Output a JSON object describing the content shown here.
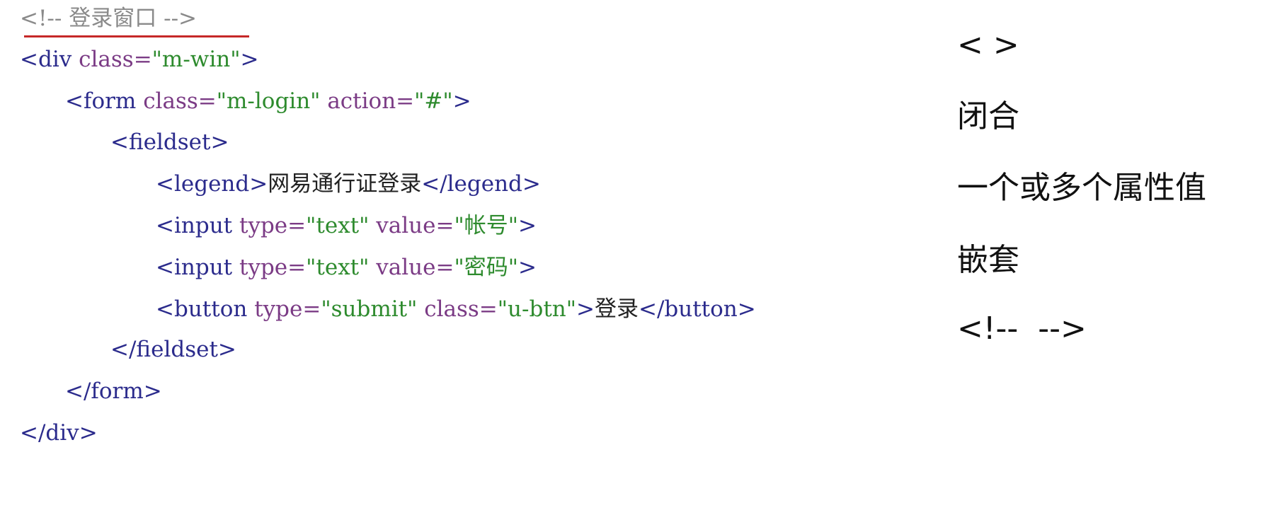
{
  "code": {
    "lines": [
      {
        "indent": 0,
        "tokens": [
          {
            "t": "<!-- 登录窗口 -->",
            "k": "comment"
          }
        ]
      },
      {
        "indent": 0,
        "tokens": [
          {
            "t": "<div ",
            "k": "tag"
          },
          {
            "t": "class",
            "k": "attr"
          },
          {
            "t": "=",
            "k": "eq"
          },
          {
            "t": "\"m-win\"",
            "k": "str"
          },
          {
            "t": ">",
            "k": "tag"
          }
        ]
      },
      {
        "indent": 1,
        "tokens": [
          {
            "t": "<form ",
            "k": "tag"
          },
          {
            "t": "class",
            "k": "attr"
          },
          {
            "t": "=",
            "k": "eq"
          },
          {
            "t": "\"m-login\"",
            "k": "str"
          },
          {
            "t": " ",
            "k": "text"
          },
          {
            "t": "action",
            "k": "attr"
          },
          {
            "t": "=",
            "k": "eq"
          },
          {
            "t": "\"#\"",
            "k": "str"
          },
          {
            "t": ">",
            "k": "tag"
          }
        ]
      },
      {
        "indent": 2,
        "tokens": [
          {
            "t": "<fieldset>",
            "k": "tag"
          }
        ]
      },
      {
        "indent": 3,
        "tokens": [
          {
            "t": "<legend>",
            "k": "tag"
          },
          {
            "t": "网易通行证登录",
            "k": "text"
          },
          {
            "t": "</legend>",
            "k": "tag"
          }
        ]
      },
      {
        "indent": 3,
        "tokens": [
          {
            "t": "<input ",
            "k": "tag"
          },
          {
            "t": "type",
            "k": "attr"
          },
          {
            "t": "=",
            "k": "eq"
          },
          {
            "t": "\"text\"",
            "k": "str"
          },
          {
            "t": " ",
            "k": "text"
          },
          {
            "t": "value",
            "k": "attr"
          },
          {
            "t": "=",
            "k": "eq"
          },
          {
            "t": "\"帐号\"",
            "k": "str"
          },
          {
            "t": ">",
            "k": "tag"
          }
        ]
      },
      {
        "indent": 3,
        "tokens": [
          {
            "t": "<input ",
            "k": "tag"
          },
          {
            "t": "type",
            "k": "attr"
          },
          {
            "t": "=",
            "k": "eq"
          },
          {
            "t": "\"text\"",
            "k": "str"
          },
          {
            "t": " ",
            "k": "text"
          },
          {
            "t": "value",
            "k": "attr"
          },
          {
            "t": "=",
            "k": "eq"
          },
          {
            "t": "\"密码\"",
            "k": "str"
          },
          {
            "t": ">",
            "k": "tag"
          }
        ]
      },
      {
        "indent": 3,
        "tokens": [
          {
            "t": "<button ",
            "k": "tag"
          },
          {
            "t": "type",
            "k": "attr"
          },
          {
            "t": "=",
            "k": "eq"
          },
          {
            "t": "\"submit\"",
            "k": "str"
          },
          {
            "t": " ",
            "k": "text"
          },
          {
            "t": "class",
            "k": "attr"
          },
          {
            "t": "=",
            "k": "eq"
          },
          {
            "t": "\"u-btn\"",
            "k": "str"
          },
          {
            "t": ">",
            "k": "tag"
          },
          {
            "t": "登录",
            "k": "text"
          },
          {
            "t": "</button>",
            "k": "tag"
          }
        ]
      },
      {
        "indent": 2,
        "tokens": [
          {
            "t": "</fieldset>",
            "k": "tag"
          }
        ]
      },
      {
        "indent": 1,
        "tokens": [
          {
            "t": "</form>",
            "k": "tag"
          }
        ]
      },
      {
        "indent": 0,
        "tokens": [
          {
            "t": "</div>",
            "k": "tag"
          }
        ]
      }
    ]
  },
  "notes": {
    "items": [
      "< >",
      "闭合",
      "一个或多个属性值",
      "嵌套",
      "<!--  -->"
    ]
  },
  "colors": {
    "comment": "#8a8a8a",
    "tag": "#2b2b8c",
    "attr": "#7b3b85",
    "string": "#2e8b2e",
    "text": "#222222",
    "underline": "#c62828"
  }
}
